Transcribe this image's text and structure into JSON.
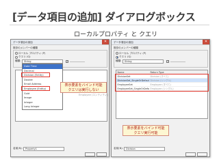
{
  "slide": {
    "title": "[データ項目の追加] ダイアログボックス",
    "subtitle": "ローカルプロパティ と クエリ"
  },
  "left_dialog": {
    "title": "データ項目の追加",
    "group_label": "既存のメンバーの種類",
    "radio_local": "ローカル プロパティ (P)",
    "radio_query": "クエリ (Q)",
    "type_label": "種類:",
    "type_value": "String",
    "name_label": "名前(N):",
    "name_value": "Property1",
    "dropdown_items": [
      "Date Time",
      "Decimal",
      "Division (Entity)",
      "Double",
      "Email Address",
      "Employee (Entity)",
      "Guid",
      "Image",
      "Integer",
      "Long Integer"
    ],
    "background_items": [
      "Division (エンティティ)",
      "Employee (エンティティ)"
    ],
    "callout": [
      "表示要素をバインド可能",
      "クエリは実行しない"
    ]
  },
  "right_dialog": {
    "title": "データ項目の追加",
    "group_label": "既存のメンバーの種類",
    "radio_local": "ローカル プロパティ (P)",
    "radio_query": "クエリ (Q)",
    "type_label": "種類:",
    "type_value": "String",
    "name_label": "名前(N):",
    "name_value": "Division",
    "grid_headers": [
      "Name",
      "Return Type"
    ],
    "grid_rows": [
      {
        "name": "DivisionSet",
        "type": "Division (すべて)"
      },
      {
        "name": "DivisionSet_SingleOrDefault",
        "type": "Division (シングル)"
      },
      {
        "name": "EmployeeSet",
        "type": "Employee (すべて)"
      },
      {
        "name": "EmployeeSet_SingleOrDefault",
        "type": "Employee (シングル)"
      }
    ],
    "callout": [
      "表示要素をバインド可能",
      "クエリ実行可能"
    ]
  }
}
